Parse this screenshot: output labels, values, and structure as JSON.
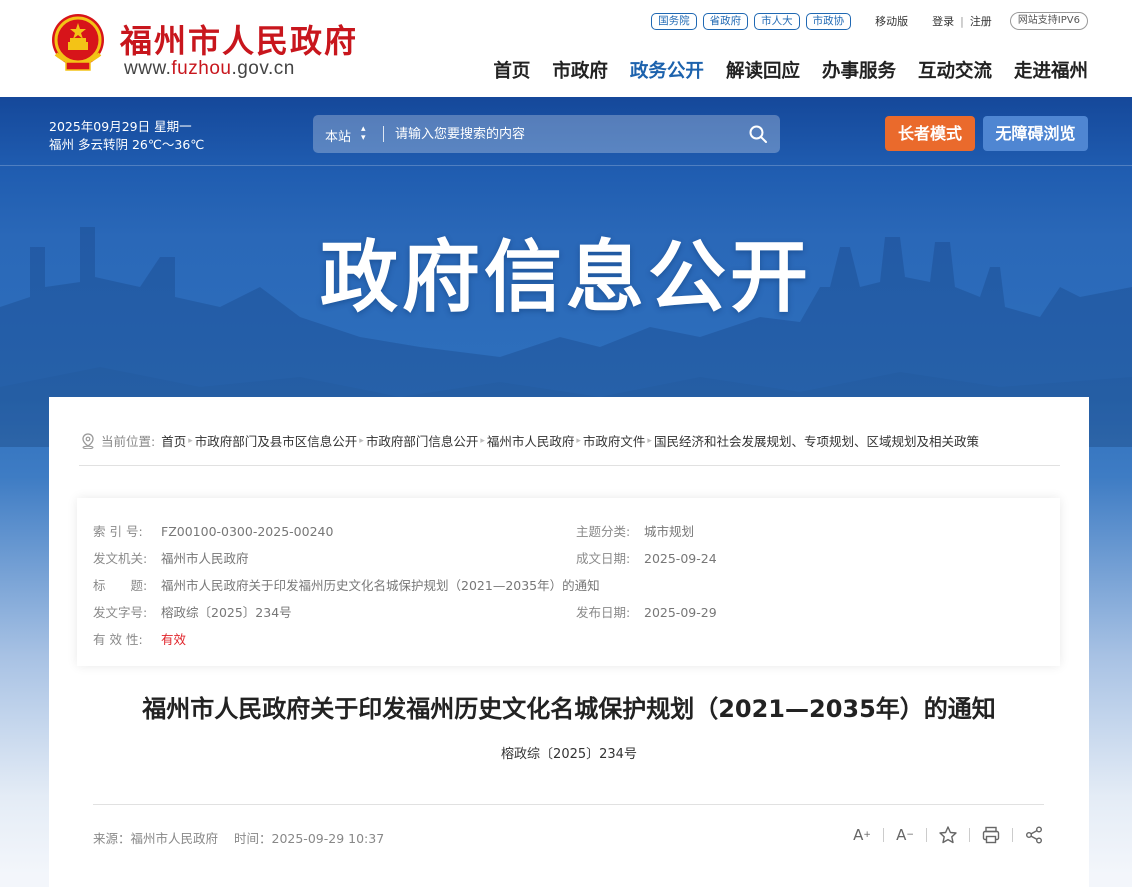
{
  "header": {
    "site_name": "福州市人民政府",
    "url_prefix": "www.",
    "url_domain": "fuzhou",
    "url_suffix": ".gov.cn",
    "top_links": [
      "国务院",
      "省政府",
      "市人大",
      "市政协"
    ],
    "mobile": "移动版",
    "login": "登录",
    "register": "注册",
    "ipv6": "网站支持IPV6",
    "nav": [
      "首页",
      "市政府",
      "政务公开",
      "解读回应",
      "办事服务",
      "互动交流",
      "走进福州"
    ],
    "active_nav": "政务公开"
  },
  "toolbar": {
    "date": "2025年09月29日 星期一",
    "weather": "福州 多云转阴 26℃～36℃",
    "search_scope": "本站",
    "search_placeholder": "请输入您要搜索的内容",
    "elder_mode": "长者模式",
    "accessible": "无障碍浏览"
  },
  "banner_title": "政府信息公开",
  "breadcrumb": {
    "label": "当前位置:",
    "items": [
      "首页",
      "市政府部门及县市区信息公开",
      "市政府部门信息公开",
      "福州市人民政府",
      "市政府文件",
      "国民经济和社会发展规划、专项规划、区域规划及相关政策"
    ]
  },
  "meta": {
    "index_label": "索 引 号:",
    "index_value": "FZ00100-0300-2025-00240",
    "topic_label": "主题分类:",
    "topic_value": "城市规划",
    "issuer_label": "发文机关:",
    "issuer_value": "福州市人民政府",
    "written_label": "成文日期:",
    "written_value": "2025-09-24",
    "title_label": "标　　题:",
    "title_value": "福州市人民政府关于印发福州历史文化名城保护规划（2021—2035年）的通知",
    "docno_label": "发文字号:",
    "docno_value": "榕政综〔2025〕234号",
    "published_label": "发布日期:",
    "published_value": "2025-09-29",
    "validity_label": "有 效 性:",
    "validity_value": "有效"
  },
  "document": {
    "title": "福州市人民政府关于印发福州历史文化名城保护规划（2021—2035年）的通知",
    "number": "榕政综〔2025〕234号",
    "source": "来源：福州市人民政府",
    "time": "时间：2025-09-29 10:37",
    "font_up": "A",
    "font_down": "A"
  },
  "colors": {
    "brand_red": "#c8161d",
    "nav_active": "#1c62ad",
    "elder": "#ea6a2c",
    "accessible": "#4f86d2",
    "valid": "#e0252b"
  }
}
